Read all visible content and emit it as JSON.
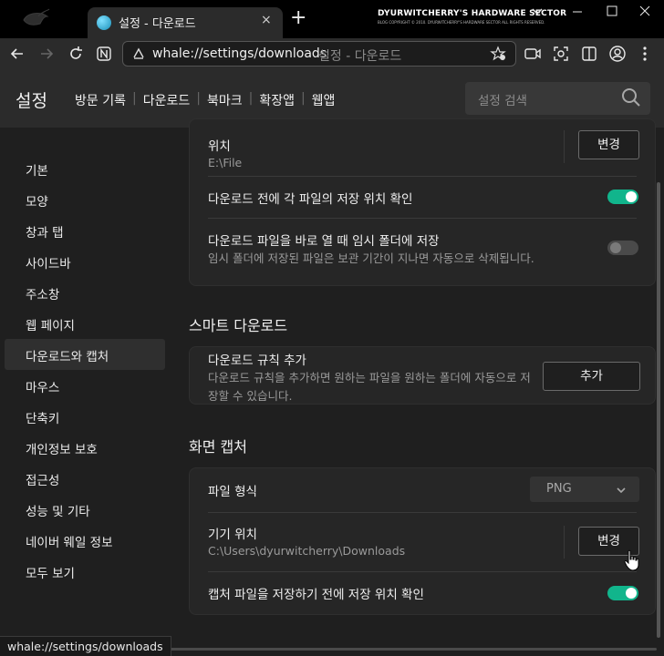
{
  "browser": {
    "tab_title": "설정 - 다운로드",
    "tab_close": "×",
    "new_tab": "+",
    "brand_title": "DYURWITCHERRY'S HARDWARE SECTOR",
    "brand_sub": "BLOG COPYRIGHT © 2010. DYURWITCHERRY'S HARDWARE SECTOR ALL RIGHTS RESERVED.",
    "url": "whale://settings/downloads",
    "page_title": "설정 - 다운로드",
    "status_url": "whale://settings/downloads"
  },
  "header": {
    "title": "설정",
    "nav": [
      "방문 기록",
      "다운로드",
      "북마크",
      "확장앱",
      "웹앱"
    ],
    "search_placeholder": "설정 검색"
  },
  "sidebar": {
    "items": [
      {
        "label": "기본"
      },
      {
        "label": "모양"
      },
      {
        "label": "창과 탭"
      },
      {
        "label": "사이드바"
      },
      {
        "label": "주소창"
      },
      {
        "label": "웹 페이지"
      },
      {
        "label": "다운로드와 캡처",
        "active": true
      },
      {
        "label": "마우스"
      },
      {
        "label": "단축키"
      },
      {
        "label": "개인정보 보호"
      },
      {
        "label": "접근성"
      },
      {
        "label": "성능 및 기타"
      },
      {
        "label": "네이버 웨일 정보"
      },
      {
        "label": "모두 보기"
      }
    ]
  },
  "download": {
    "location_label": "위치",
    "location_value": "E:\\File",
    "change_button": "변경",
    "ask_before_label": "다운로드 전에 각 파일의 저장 위치 확인",
    "ask_before_on": true,
    "temp_label": "다운로드 파일을 바로 열 때 임시 폴더에 저장",
    "temp_desc": "임시 폴더에 저장된 파일은 보관 기간이 지나면 자동으로 삭제됩니다.",
    "temp_on": false
  },
  "smart": {
    "section_title": "스마트 다운로드",
    "rule_label": "다운로드 규칙 추가",
    "rule_desc_1": "다운로드 규칙을 추가하면 원하는 파일을 원하는 폴더에 자동으로 저",
    "rule_desc_2": "장할 수 있습니다.",
    "add_button": "추가"
  },
  "capture": {
    "section_title": "화면 캡처",
    "format_label": "파일 형식",
    "format_value": "PNG",
    "device_label": "기기 위치",
    "device_value": "C:\\Users\\dyurwitcherry\\Downloads",
    "change_button": "변경",
    "ask_before_label": "캡처 파일을 저장하기 전에 저장 위치 확인",
    "ask_before_on": true
  },
  "colors": {
    "accent": "#11b58c",
    "background": "#1f1f1f",
    "card": "#262626"
  }
}
